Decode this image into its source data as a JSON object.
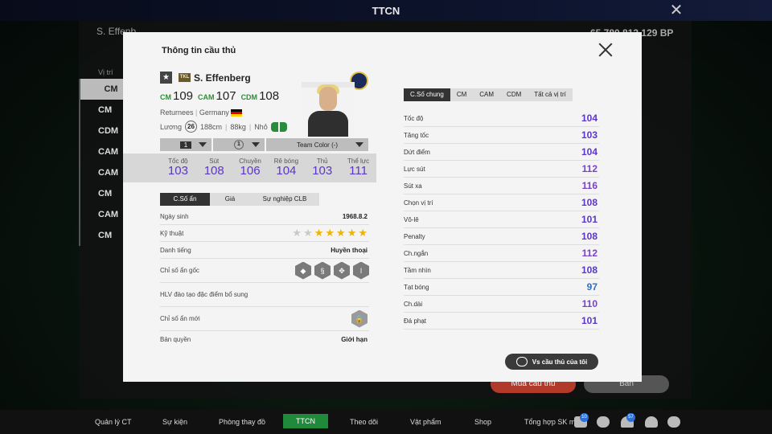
{
  "window": {
    "title": "TTCN",
    "search_text": "S. Effenb",
    "bp": "65,780,813,129 BP",
    "sub_label": "Cầu",
    "list_header": "Vị trí",
    "list_items": [
      "CM",
      "CM",
      "CDM",
      "CAM",
      "CAM",
      "CM",
      "CAM",
      "CM"
    ],
    "buy_btn": "Mua cầu thủ",
    "sell_btn": "Bán"
  },
  "bottom_nav": {
    "items": [
      "Quản lý CT",
      "Sự kiện",
      "Phòng thay đồ",
      "TTCN",
      "Theo dõi",
      "Vật phẩm",
      "Shop",
      "Tổng hợp SK mới"
    ],
    "active": "TTCN",
    "badge1": "10",
    "badge2": "57"
  },
  "modal": {
    "title": "Thông tin cầu thủ",
    "player": {
      "season": "TKL",
      "name": "S. Effenberg",
      "positions": [
        {
          "pos": "CM",
          "val": "109",
          "color": "#2f8c3a"
        },
        {
          "pos": "CAM",
          "val": "107",
          "color": "#2f8c3a"
        },
        {
          "pos": "CDM",
          "val": "108",
          "color": "#2f8c3a"
        }
      ],
      "class": "Returnees",
      "nation": "Germany",
      "salary_label": "Lương",
      "salary": "26",
      "height": "188cm",
      "weight": "88kg",
      "body": "Nhỏ"
    },
    "selectors": {
      "level": "1",
      "team_color": "Team Color (-)",
      "enhance": "1"
    },
    "main_stats": [
      {
        "label": "Tốc độ",
        "value": "103"
      },
      {
        "label": "Sút",
        "value": "108"
      },
      {
        "label": "Chuyền",
        "value": "106"
      },
      {
        "label": "Rê bóng",
        "value": "104"
      },
      {
        "label": "Thủ",
        "value": "103"
      },
      {
        "label": "Thể lực",
        "value": "111"
      }
    ],
    "left_tabs": [
      "C.Số ẩn",
      "Giá",
      "Sự nghiệp CLB"
    ],
    "info": {
      "birth_label": "Ngày sinh",
      "birth": "1968.8.2",
      "skill_label": "Kỹ thuật",
      "skill_stars": 5,
      "fame_label": "Danh tiếng",
      "fame": "Huyền thoại",
      "hidden_label": "Chỉ số ẩn gốc",
      "coach_label": "HLV đào tạo đặc điểm bổ sung",
      "new_hidden_label": "Chỉ số ẩn mới",
      "rights_label": "Bản quyền",
      "rights": "Giới hạn"
    },
    "right_tabs": [
      "C.Số chung",
      "CM",
      "CAM",
      "CDM",
      "Tất cả vị trí"
    ],
    "right_stats": [
      {
        "label": "Tốc độ",
        "value": "104",
        "color": "#5b36c9"
      },
      {
        "label": "Tăng tốc",
        "value": "103",
        "color": "#5b36c9"
      },
      {
        "label": "Dứt điểm",
        "value": "104",
        "color": "#5b36c9"
      },
      {
        "label": "Lực sút",
        "value": "112",
        "color": "#7b3fd0"
      },
      {
        "label": "Sút xa",
        "value": "116",
        "color": "#7b3fd0"
      },
      {
        "label": "Chọn vị trí",
        "value": "108",
        "color": "#5b36c9"
      },
      {
        "label": "Vô-lê",
        "value": "101",
        "color": "#5b36c9"
      },
      {
        "label": "Penalty",
        "value": "108",
        "color": "#5b36c9"
      },
      {
        "label": "Ch.ngắn",
        "value": "112",
        "color": "#7b3fd0"
      },
      {
        "label": "Tầm nhìn",
        "value": "108",
        "color": "#5b36c9"
      },
      {
        "label": "Tạt bóng",
        "value": "97",
        "color": "#2a6fc9"
      },
      {
        "label": "Ch.dài",
        "value": "110",
        "color": "#7b3fd0"
      },
      {
        "label": "Đá phạt",
        "value": "101",
        "color": "#5b36c9"
      }
    ],
    "compare_btn": "Vs cầu thủ của tôi"
  }
}
